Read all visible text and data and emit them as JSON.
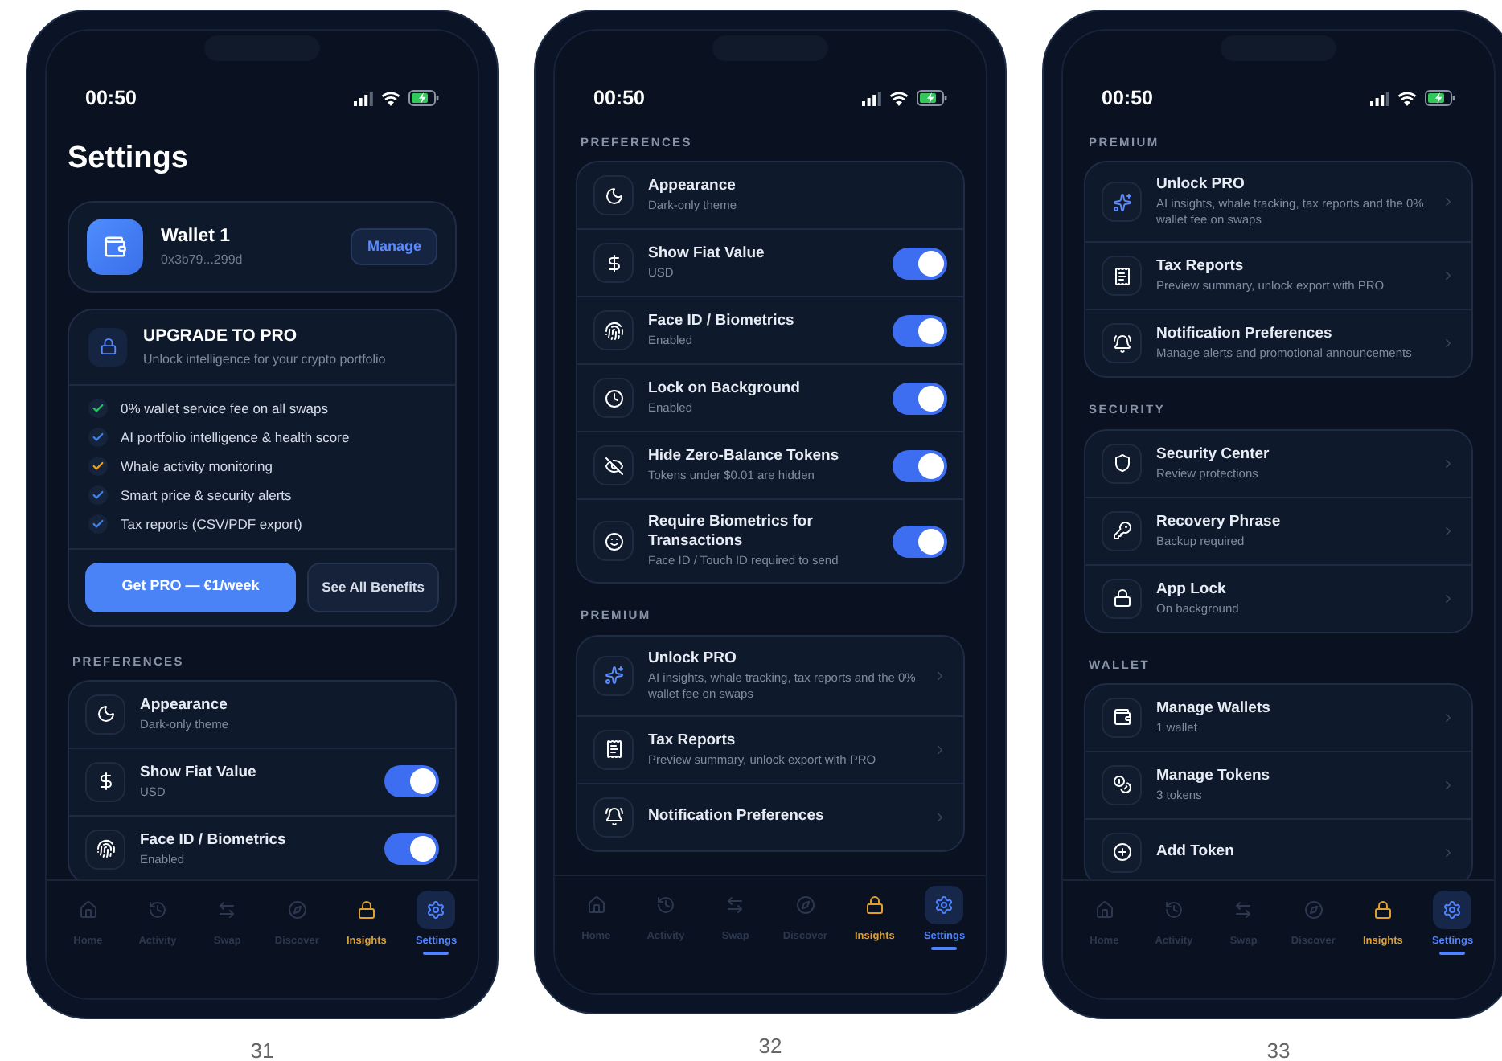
{
  "phones": [
    {
      "caption": "31",
      "time": "00:50",
      "title": "Settings",
      "wallet": {
        "name": "Wallet 1",
        "address": "0x3b79...299d",
        "button": "Manage"
      },
      "upgrade": {
        "title": "UPGRADE TO PRO",
        "subtitle": "Unlock intelligence for your crypto portfolio",
        "features": [
          {
            "text": "0% wallet service fee on all swaps",
            "color": "#22c55e"
          },
          {
            "text": "AI portfolio intelligence & health score",
            "color": "#3b82f6"
          },
          {
            "text": "Whale activity monitoring",
            "color": "#f59e0b"
          },
          {
            "text": "Smart price & security alerts",
            "color": "#3b82f6"
          },
          {
            "text": "Tax reports (CSV/PDF export)",
            "color": "#3b82f6"
          }
        ],
        "primary_button": "Get PRO — €1/week",
        "secondary_button": "See All Benefits"
      },
      "sections": [
        {
          "kind": "preferences",
          "header": "PREFERENCES",
          "rows": [
            {
              "kind": "plain",
              "title": "Appearance",
              "subtitle": "Dark-only theme"
            },
            {
              "kind": "toggle",
              "title": "Show Fiat Value",
              "subtitle": "USD",
              "on": true
            },
            {
              "kind": "toggle",
              "title": "Face ID / Biometrics",
              "subtitle": "Enabled",
              "on": true
            }
          ]
        }
      ],
      "tabs": [
        {
          "label": "Home",
          "kind": "normal",
          "selected": false
        },
        {
          "label": "Activity",
          "kind": "normal",
          "selected": false
        },
        {
          "label": "Swap",
          "kind": "normal",
          "selected": false
        },
        {
          "label": "Discover",
          "kind": "normal",
          "selected": false
        },
        {
          "label": "Insights",
          "kind": "pro",
          "selected": false
        },
        {
          "label": "Settings",
          "kind": "normal",
          "selected": true
        }
      ]
    },
    {
      "caption": "32",
      "time": "00:50",
      "sections": [
        {
          "kind": "preferences",
          "header": "PREFERENCES",
          "rows": [
            {
              "kind": "plain",
              "title": "Appearance",
              "subtitle": "Dark-only theme"
            },
            {
              "kind": "toggle",
              "title": "Show Fiat Value",
              "subtitle": "USD",
              "on": true
            },
            {
              "kind": "toggle",
              "title": "Face ID / Biometrics",
              "subtitle": "Enabled",
              "on": true
            },
            {
              "kind": "toggle",
              "title": "Lock on Background",
              "subtitle": "Enabled",
              "on": true
            },
            {
              "kind": "toggle",
              "title": "Hide Zero-Balance Tokens",
              "subtitle": "Tokens under $0.01 are hidden",
              "on": true
            },
            {
              "kind": "toggle",
              "title": "Require Biometrics for Transactions",
              "subtitle": "Face ID / Touch ID required to send",
              "on": true
            }
          ]
        },
        {
          "kind": "premium",
          "header": "PREMIUM",
          "rows": [
            {
              "kind": "link",
              "title": "Unlock PRO",
              "subtitle": "AI insights, whale tracking, tax reports and the 0% wallet fee on swaps"
            },
            {
              "kind": "link",
              "title": "Tax Reports",
              "subtitle": "Preview summary, unlock export with PRO"
            },
            {
              "kind": "link",
              "title": "Notification Preferences"
            }
          ]
        }
      ],
      "tabs": [
        {
          "label": "Home",
          "kind": "normal",
          "selected": false
        },
        {
          "label": "Activity",
          "kind": "normal",
          "selected": false
        },
        {
          "label": "Swap",
          "kind": "normal",
          "selected": false
        },
        {
          "label": "Discover",
          "kind": "normal",
          "selected": false
        },
        {
          "label": "Insights",
          "kind": "pro",
          "selected": false
        },
        {
          "label": "Settings",
          "kind": "normal",
          "selected": true
        }
      ]
    },
    {
      "caption": "33",
      "time": "00:50",
      "sections": [
        {
          "kind": "premium",
          "header": "PREMIUM",
          "rows": [
            {
              "kind": "link",
              "title": "Unlock PRO",
              "subtitle": "AI insights, whale tracking, tax reports and the 0% wallet fee on swaps"
            },
            {
              "kind": "link",
              "title": "Tax Reports",
              "subtitle": "Preview summary, unlock export with PRO"
            },
            {
              "kind": "link",
              "title": "Notification Preferences",
              "subtitle": "Manage alerts and promotional announcements"
            }
          ]
        },
        {
          "kind": "security",
          "header": "SECURITY",
          "rows": [
            {
              "kind": "link",
              "title": "Security Center",
              "subtitle": "Review protections"
            },
            {
              "kind": "link",
              "title": "Recovery Phrase",
              "subtitle": "Backup required"
            },
            {
              "kind": "link",
              "title": "App Lock",
              "subtitle": "On background"
            }
          ]
        },
        {
          "kind": "wallet",
          "header": "WALLET",
          "rows": [
            {
              "kind": "link",
              "title": "Manage Wallets",
              "subtitle": "1 wallet"
            },
            {
              "kind": "link",
              "title": "Manage Tokens",
              "subtitle": "3 tokens"
            },
            {
              "kind": "link",
              "title": "Add Token"
            }
          ]
        }
      ],
      "tabs": [
        {
          "label": "Home",
          "kind": "normal",
          "selected": false
        },
        {
          "label": "Activity",
          "kind": "normal",
          "selected": false
        },
        {
          "label": "Swap",
          "kind": "normal",
          "selected": false
        },
        {
          "label": "Discover",
          "kind": "normal",
          "selected": false
        },
        {
          "label": "Insights",
          "kind": "pro",
          "selected": false
        },
        {
          "label": "Settings",
          "kind": "normal",
          "selected": true
        }
      ]
    }
  ]
}
